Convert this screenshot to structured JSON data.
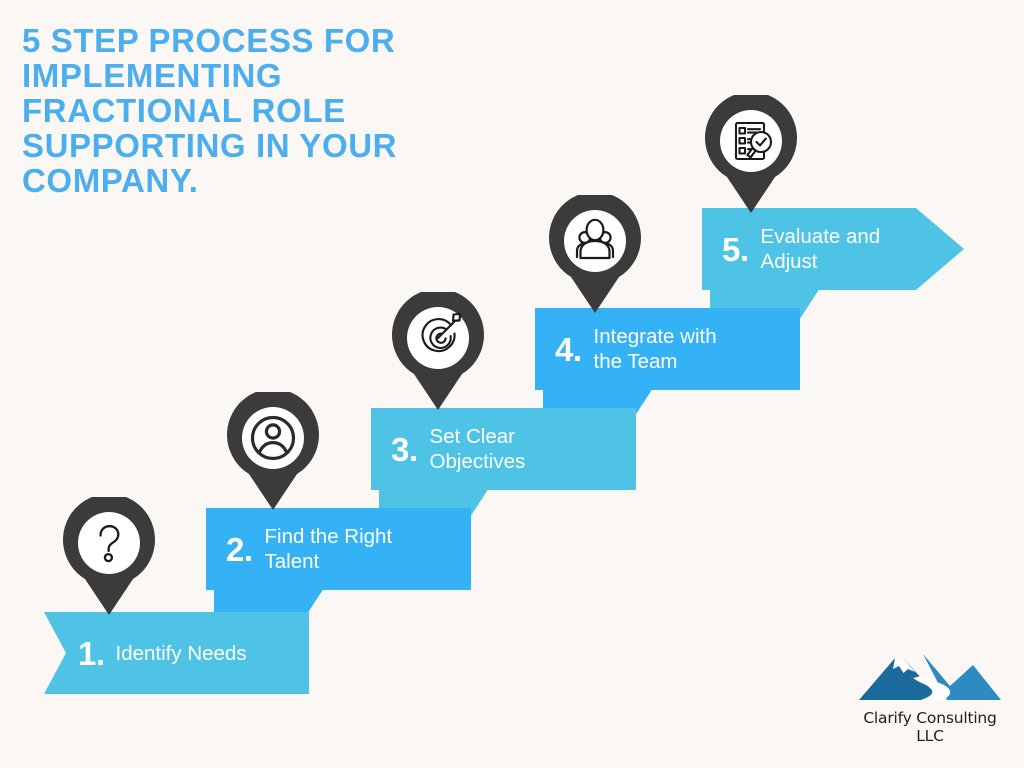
{
  "page": {
    "background_color": "#fbf7f5",
    "title": "5 Step Process for Implementing Fractional Role Supporting in Your Company.",
    "title_display": "5 STEP PROCESS FOR\nIMPLEMENTING\nFRACTIONAL ROLE\nSUPPORTING IN YOUR\nCOMPANY.",
    "title_color": "#4baeef"
  },
  "colors": {
    "light_blue": "#4ec3e6",
    "dark_blue": "#35b2f5",
    "pin_dark": "#3b3b3b",
    "pin_face": "#ffffff",
    "text_white": "#ffffff",
    "logo_blue_dark": "#1b6a9c",
    "logo_blue_light": "#2e8bbf",
    "logo_text": "#231f20"
  },
  "steps": [
    {
      "number": "1.",
      "label": "Identify Needs",
      "icon": "question-mark-icon",
      "banner_color": "#4ec3e6"
    },
    {
      "number": "2.",
      "label": "Find the Right\nTalent",
      "icon": "user-avatar-icon",
      "banner_color": "#35b2f5"
    },
    {
      "number": "3.",
      "label": "Set Clear\nObjectives",
      "icon": "target-dartboard-icon",
      "banner_color": "#4ec3e6"
    },
    {
      "number": "4.",
      "label": "Integrate with\nthe Team",
      "icon": "team-group-icon",
      "banner_color": "#35b2f5"
    },
    {
      "number": "5.",
      "label": "Evaluate and\nAdjust",
      "icon": "checklist-review-icon",
      "banner_color": "#4ec3e6"
    }
  ],
  "logo": {
    "name": "Clarify Consulting LLC",
    "mark": "mountain-river-logo-icon"
  }
}
